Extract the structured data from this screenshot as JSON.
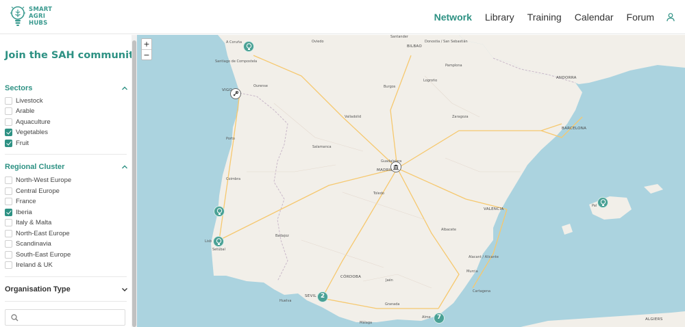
{
  "header": {
    "logo_lines": [
      "SMART",
      "AGRI",
      "HUBS"
    ],
    "nav": [
      {
        "label": "Network",
        "active": true
      },
      {
        "label": "Library",
        "active": false
      },
      {
        "label": "Training",
        "active": false
      },
      {
        "label": "Calendar",
        "active": false
      },
      {
        "label": "Forum",
        "active": false
      }
    ],
    "user_icon": "user-icon",
    "accent_color": "#2d9183"
  },
  "sidebar": {
    "title": "Join the SAH community",
    "sectors": {
      "heading": "Sectors",
      "expanded": true,
      "items": [
        {
          "label": "Livestock",
          "checked": false
        },
        {
          "label": "Arable",
          "checked": false
        },
        {
          "label": "Aquaculture",
          "checked": false
        },
        {
          "label": "Vegetables",
          "checked": true
        },
        {
          "label": "Fruit",
          "checked": true
        }
      ]
    },
    "regional_cluster": {
      "heading": "Regional Cluster",
      "expanded": true,
      "items": [
        {
          "label": "North-West Europe",
          "checked": false
        },
        {
          "label": "Central Europe",
          "checked": false
        },
        {
          "label": "France",
          "checked": false
        },
        {
          "label": "Iberia",
          "checked": true
        },
        {
          "label": "Italy & Malta",
          "checked": false
        },
        {
          "label": "North-East Europe",
          "checked": false
        },
        {
          "label": "Scandinavia",
          "checked": false
        },
        {
          "label": "South-East Europe",
          "checked": false
        },
        {
          "label": "Ireland & UK",
          "checked": false
        }
      ]
    },
    "organisation_type": {
      "heading": "Organisation Type",
      "expanded": false
    },
    "search": {
      "value": "",
      "placeholder": ""
    }
  },
  "map": {
    "zoom_in": "+",
    "zoom_out": "−",
    "cities": {
      "a_coruna": "A Coruña",
      "santiago": "Santiago de Compostela",
      "vigo": "VIGO",
      "ourense": "Ourense",
      "oviedo": "Oviedo",
      "santander": "Santander",
      "bilbao": "BILBAO",
      "donostia": "Donostia / San Sebastián",
      "pamplona": "Pamplona",
      "burgos": "Burgos",
      "logrono": "Logroño",
      "valladolid": "Valladolid",
      "zaragoza": "Zaragoza",
      "andorra": "ANDORRA",
      "barcelona": "BARCELONA",
      "porto": "Porto",
      "salamanca": "Salamanca",
      "guadalajara": "Guadalajara",
      "madrid": "MADRID",
      "coimbra": "Coimbra",
      "toledo": "Toledo",
      "valencia": "VALENCIA",
      "albacete": "Albacete",
      "badajoz": "Badajoz",
      "lisbon": "Lisb",
      "setubal": "Setúbal",
      "palma": "Pal",
      "alacant": "Alacant / Alicante",
      "murcia": "Murcia",
      "cordoba": "CÓRDOBA",
      "jaen": "Jaén",
      "sevilla": "SEVIL",
      "granada": "Granada",
      "huelva": "Huelva",
      "almeria": "Alme",
      "malaga": "Málaga",
      "cartagena": "Cartagena",
      "algiers": "ALGIERS"
    },
    "clusters": [
      {
        "id": "sevilla",
        "count": "2"
      },
      {
        "id": "almeria",
        "count": "7"
      }
    ],
    "markers": [
      {
        "name": "a-coruna",
        "icon": "bulb-icon"
      },
      {
        "name": "vigo",
        "icon": "tool-icon"
      },
      {
        "name": "madrid",
        "icon": "building-icon"
      },
      {
        "name": "central-portugal",
        "icon": "bulb-icon"
      },
      {
        "name": "lisbon",
        "icon": "bulb-icon"
      },
      {
        "name": "mallorca",
        "icon": "bulb-icon"
      }
    ],
    "colors": {
      "sea": "#abd3df",
      "land": "#f2efe9",
      "marker": "#4aa195",
      "road": "#f6c86e"
    }
  }
}
